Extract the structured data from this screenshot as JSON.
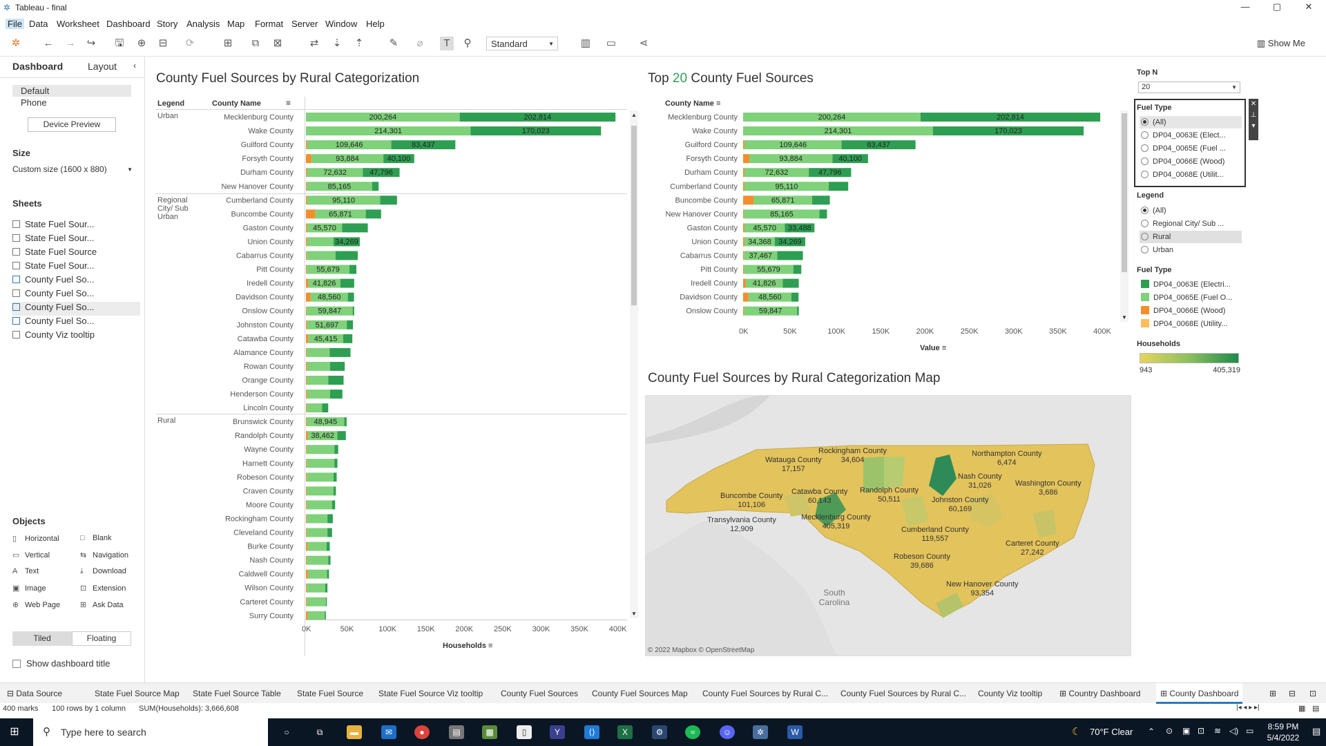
{
  "window": {
    "title": "Tableau - final",
    "min": "—",
    "max": "▢",
    "close": "✕"
  },
  "menu": [
    "File",
    "Data",
    "Worksheet",
    "Dashboard",
    "Story",
    "Analysis",
    "Map",
    "Format",
    "Server",
    "Window",
    "Help"
  ],
  "toolbar": {
    "fit": "Standard",
    "show_me": "Show Me"
  },
  "sidebar": {
    "tab_dashboard": "Dashboard",
    "tab_layout": "Layout",
    "devices": [
      "Default",
      "Phone"
    ],
    "device_preview": "Device Preview",
    "size_heading": "Size",
    "size_value": "Custom size (1600 x 880)",
    "sheets_heading": "Sheets",
    "sheets": [
      "State Fuel Sour...",
      "State Fuel Sour...",
      "State Fuel Source",
      "State Fuel Sour...",
      "County Fuel So...",
      "County Fuel So...",
      "County Fuel So...",
      "County Fuel So...",
      "County Viz tooltip"
    ],
    "objects_heading": "Objects",
    "objects": [
      [
        "▯",
        "Horizontal"
      ],
      [
        "□",
        "Blank"
      ],
      [
        "▭",
        "Vertical"
      ],
      [
        "⇆",
        "Navigation"
      ],
      [
        "A",
        "Text"
      ],
      [
        "⤓",
        "Download"
      ],
      [
        "▣",
        "Image"
      ],
      [
        "⊡",
        "Extension"
      ],
      [
        "⊕",
        "Web Page"
      ],
      [
        "⊞",
        "Ask Data"
      ]
    ],
    "tiled": "Tiled",
    "floating": "Floating",
    "show_title": "Show dashboard title"
  },
  "left_chart": {
    "title": "County Fuel Sources by Rural Categorization",
    "col_legend": "Legend",
    "col_county": "County Name",
    "segments": [
      "Urban",
      "Regional City/ Sub Urban",
      "Rural"
    ],
    "xaxis": {
      "ticks": [
        "0K",
        "50K",
        "100K",
        "150K",
        "200K",
        "250K",
        "300K",
        "350K",
        "400K"
      ],
      "label": "Households"
    }
  },
  "right_chart": {
    "title_pre": "Top",
    "title_n": "20",
    "title_post": "County Fuel Sources",
    "col_county": "County Name",
    "xaxis": {
      "ticks": [
        "0K",
        "50K",
        "100K",
        "150K",
        "200K",
        "250K",
        "300K",
        "350K",
        "400K"
      ],
      "label": "Value"
    }
  },
  "map": {
    "title": "County Fuel Sources by Rural Categorization Map",
    "credit": "© 2022 Mapbox © OpenStreetMap",
    "state_label": "South Carolina",
    "labels": [
      [
        "Rockingham County",
        "34,604"
      ],
      [
        "Northampton County",
        "6,474"
      ],
      [
        "Watauga County",
        "17,157"
      ],
      [
        "Nash County",
        "31,026"
      ],
      [
        "Washington County",
        "3,686"
      ],
      [
        "Randolph County",
        "50,511"
      ],
      [
        "Catawba County",
        "60,143"
      ],
      [
        "Buncombe County",
        "101,106"
      ],
      [
        "Johnston County",
        "60,169"
      ],
      [
        "Transylvania County",
        "12,909"
      ],
      [
        "Mecklenburg County",
        "405,319"
      ],
      [
        "Cumberland County",
        "119,557"
      ],
      [
        "Carteret County",
        "27,242"
      ],
      [
        "Robeson County",
        "39,686"
      ],
      [
        "New Hanover County",
        "93,354"
      ]
    ]
  },
  "filters": {
    "topn_title": "Top N",
    "topn_value": "20",
    "fuel_title": "Fuel Type",
    "fuel_options": [
      "(All)",
      "DP04_0063E (Elect...",
      "DP04_0065E (Fuel ...",
      "DP04_0066E (Wood)",
      "DP04_0068E (Utilit..."
    ],
    "legend_title": "Legend",
    "legend_options": [
      "(All)",
      "Regional City/ Sub ...",
      "Rural",
      "Urban"
    ],
    "fueltype_legend_title": "Fuel Type",
    "fueltype_legend": [
      "DP04_0063E (Electri...",
      "DP04_0065E (Fuel O...",
      "DP04_0066E (Wood)",
      "DP04_0068E (Utility..."
    ],
    "households_title": "Households",
    "households_min": "943",
    "households_max": "405,319"
  },
  "colors": {
    "electric": "#2e9e52",
    "fuel_oil": "#7fd17a",
    "wood": "#f28e2b",
    "utility": "#ffbe5c",
    "bar_light": "#84d47d",
    "bar_dark": "#2f9b4f"
  },
  "tabs": [
    "Data Source",
    "State Fuel Source Map",
    "State Fuel Source Table",
    "State Fuel Source",
    "State Fuel Source Viz tooltip",
    "County Fuel Sources",
    "County Fuel Sources Map",
    "County Fuel Sources by Rural C...",
    "County Fuel Sources by Rural C...",
    "County Viz tooltip",
    "Country Dashboard",
    "County Dashboard"
  ],
  "status": {
    "marks": "400 marks",
    "rows": "100 rows by 1 column",
    "sum": "SUM(Households): 3,666,608"
  },
  "taskbar": {
    "search": "Type here to search",
    "weather": "70°F  Clear",
    "time": "8:59 PM",
    "date": "5/4/2022"
  },
  "chart_data": [
    {
      "type": "bar",
      "title": "County Fuel Sources by Rural Categorization",
      "xlabel": "Households",
      "xlim": [
        0,
        420000
      ],
      "rows": [
        {
          "segment": "Urban",
          "county": "Mecklenburg County",
          "wood": 0,
          "fuel_oil": 200264,
          "electric": 202814,
          "labels": [
            "200,264",
            "202,814"
          ]
        },
        {
          "segment": "Urban",
          "county": "Wake County",
          "wood": 0,
          "fuel_oil": 214301,
          "electric": 170023,
          "labels": [
            "214,301",
            "170,023"
          ]
        },
        {
          "segment": "Urban",
          "county": "Guilford County",
          "wood": 1500,
          "fuel_oil": 109646,
          "electric": 83437,
          "labels": [
            "109,646",
            "83,437"
          ]
        },
        {
          "segment": "Urban",
          "county": "Forsyth County",
          "wood": 7000,
          "fuel_oil": 93884,
          "electric": 40100,
          "labels": [
            "93,884",
            "40,100"
          ]
        },
        {
          "segment": "Urban",
          "county": "Durham County",
          "wood": 1500,
          "fuel_oil": 72632,
          "electric": 47796,
          "labels": [
            "72,632",
            "47,796"
          ]
        },
        {
          "segment": "Urban",
          "county": "New Hanover County",
          "wood": 1000,
          "fuel_oil": 85165,
          "electric": 8500,
          "labels": [
            "85,165",
            ""
          ]
        },
        {
          "segment": "Regional City/ Sub Urban",
          "county": "Cumberland County",
          "wood": 1500,
          "fuel_oil": 95110,
          "electric": 22000,
          "labels": [
            "95,110",
            ""
          ]
        },
        {
          "segment": "Regional City/ Sub Urban",
          "county": "Buncombe County",
          "wood": 12000,
          "fuel_oil": 65871,
          "electric": 20000,
          "labels": [
            "65,871",
            ""
          ]
        },
        {
          "segment": "Regional City/ Sub Urban",
          "county": "Gaston County",
          "wood": 1500,
          "fuel_oil": 45570,
          "electric": 33488,
          "labels": [
            "45,570",
            ""
          ]
        },
        {
          "segment": "Regional City/ Sub Urban",
          "county": "Union County",
          "wood": 1500,
          "fuel_oil": 34368,
          "electric": 34269,
          "labels": [
            "",
            "34,269"
          ]
        },
        {
          "segment": "Regional City/ Sub Urban",
          "county": "Cabarrus County",
          "wood": 1000,
          "fuel_oil": 37467,
          "electric": 29000,
          "labels": [
            "",
            ""
          ]
        },
        {
          "segment": "Regional City/ Sub Urban",
          "county": "Pitt County",
          "wood": 1000,
          "fuel_oil": 55679,
          "electric": 9000,
          "labels": [
            "55,679",
            ""
          ]
        },
        {
          "segment": "Regional City/ Sub Urban",
          "county": "Iredell County",
          "wood": 3000,
          "fuel_oil": 41826,
          "electric": 18000,
          "labels": [
            "41,826",
            ""
          ]
        },
        {
          "segment": "Regional City/ Sub Urban",
          "county": "Davidson County",
          "wood": 6000,
          "fuel_oil": 48560,
          "electric": 8000,
          "labels": [
            "48,560",
            ""
          ]
        },
        {
          "segment": "Regional City/ Sub Urban",
          "county": "Onslow County",
          "wood": 1000,
          "fuel_oil": 59847,
          "electric": 2000,
          "labels": [
            "59,847",
            ""
          ]
        },
        {
          "segment": "Regional City/ Sub Urban",
          "county": "Johnston County",
          "wood": 1500,
          "fuel_oil": 51697,
          "electric": 8000,
          "labels": [
            "51,697",
            ""
          ]
        },
        {
          "segment": "Regional City/ Sub Urban",
          "county": "Catawba County",
          "wood": 3000,
          "fuel_oil": 45415,
          "electric": 12000,
          "labels": [
            "45,415",
            ""
          ]
        },
        {
          "segment": "Regional City/ Sub Urban",
          "county": "Alamance County",
          "wood": 1000,
          "fuel_oil": 30000,
          "electric": 27000,
          "labels": [
            "",
            ""
          ]
        },
        {
          "segment": "Regional City/ Sub Urban",
          "county": "Rowan County",
          "wood": 1500,
          "fuel_oil": 30000,
          "electric": 19000,
          "labels": [
            "",
            ""
          ]
        },
        {
          "segment": "Regional City/ Sub Urban",
          "county": "Orange County",
          "wood": 1000,
          "fuel_oil": 28000,
          "electric": 20000,
          "labels": [
            "",
            ""
          ]
        },
        {
          "segment": "Regional City/ Sub Urban",
          "county": "Henderson County",
          "wood": 1500,
          "fuel_oil": 30000,
          "electric": 16000,
          "labels": [
            "",
            ""
          ]
        },
        {
          "segment": "Regional City/ Sub Urban",
          "county": "Lincoln County",
          "wood": 1000,
          "fuel_oil": 20000,
          "electric": 8000,
          "labels": [
            "",
            ""
          ]
        },
        {
          "segment": "Rural",
          "county": "Brunswick County",
          "wood": 1000,
          "fuel_oil": 48945,
          "electric": 3000,
          "labels": [
            "48,945",
            ""
          ]
        },
        {
          "segment": "Rural",
          "county": "Randolph County",
          "wood": 2500,
          "fuel_oil": 38462,
          "electric": 11000,
          "labels": [
            "38,462",
            ""
          ]
        },
        {
          "segment": "Rural",
          "county": "Wayne County",
          "wood": 1000,
          "fuel_oil": 36000,
          "electric": 5000,
          "labels": [
            "",
            ""
          ]
        },
        {
          "segment": "Rural",
          "county": "Harnett County",
          "wood": 1000,
          "fuel_oil": 36000,
          "electric": 4000,
          "labels": [
            "",
            ""
          ]
        },
        {
          "segment": "Rural",
          "county": "Robeson County",
          "wood": 1000,
          "fuel_oil": 35000,
          "electric": 4000,
          "labels": [
            "",
            ""
          ]
        },
        {
          "segment": "Rural",
          "county": "Craven County",
          "wood": 1000,
          "fuel_oil": 35000,
          "electric": 3000,
          "labels": [
            "",
            ""
          ]
        },
        {
          "segment": "Rural",
          "county": "Moore County",
          "wood": 1000,
          "fuel_oil": 33000,
          "electric": 4000,
          "labels": [
            "",
            ""
          ]
        },
        {
          "segment": "Rural",
          "county": "Rockingham County",
          "wood": 1000,
          "fuel_oil": 27000,
          "electric": 7000,
          "labels": [
            "",
            ""
          ]
        },
        {
          "segment": "Rural",
          "county": "Cleveland County",
          "wood": 1000,
          "fuel_oil": 27000,
          "electric": 6000,
          "labels": [
            "",
            ""
          ]
        },
        {
          "segment": "Rural",
          "county": "Burke County",
          "wood": 2000,
          "fuel_oil": 25000,
          "electric": 4000,
          "labels": [
            "",
            ""
          ]
        },
        {
          "segment": "Rural",
          "county": "Nash County",
          "wood": 1000,
          "fuel_oil": 28000,
          "electric": 3000,
          "labels": [
            "",
            ""
          ]
        },
        {
          "segment": "Rural",
          "county": "Caldwell County",
          "wood": 2500,
          "fuel_oil": 25000,
          "electric": 2500,
          "labels": [
            "",
            ""
          ]
        },
        {
          "segment": "Rural",
          "county": "Wilson County",
          "wood": 1000,
          "fuel_oil": 24000,
          "electric": 3000,
          "labels": [
            "",
            ""
          ]
        },
        {
          "segment": "Rural",
          "county": "Carteret County",
          "wood": 1000,
          "fuel_oil": 25000,
          "electric": 1200,
          "labels": [
            "",
            ""
          ]
        },
        {
          "segment": "Rural",
          "county": "Surry County",
          "wood": 2500,
          "fuel_oil": 22000,
          "electric": 1500,
          "labels": [
            "",
            ""
          ]
        }
      ]
    },
    {
      "type": "bar",
      "title": "Top 20 County Fuel Sources",
      "xlabel": "Value",
      "xlim": [
        0,
        410000
      ],
      "rows": [
        {
          "county": "Mecklenburg County",
          "wood": 0,
          "fuel_oil": 200264,
          "electric": 202814,
          "labels": [
            "200,264",
            "202,814"
          ]
        },
        {
          "county": "Wake County",
          "wood": 0,
          "fuel_oil": 214301,
          "electric": 170023,
          "labels": [
            "214,301",
            "170,023"
          ]
        },
        {
          "county": "Guilford County",
          "wood": 1500,
          "fuel_oil": 109646,
          "electric": 83437,
          "labels": [
            "109,646",
            "83,437"
          ]
        },
        {
          "county": "Forsyth County",
          "wood": 7000,
          "fuel_oil": 93884,
          "electric": 40100,
          "labels": [
            "93,884",
            "40,100"
          ]
        },
        {
          "county": "Durham County",
          "wood": 1500,
          "fuel_oil": 72632,
          "electric": 47796,
          "labels": [
            "72,632",
            "47,796"
          ]
        },
        {
          "county": "Cumberland County",
          "wood": 1500,
          "fuel_oil": 95110,
          "electric": 22000,
          "labels": [
            "95,110",
            ""
          ]
        },
        {
          "county": "Buncombe County",
          "wood": 12000,
          "fuel_oil": 65871,
          "electric": 20000,
          "labels": [
            "65,871",
            ""
          ]
        },
        {
          "county": "New Hanover County",
          "wood": 1000,
          "fuel_oil": 85165,
          "electric": 8500,
          "labels": [
            "85,165",
            ""
          ]
        },
        {
          "county": "Gaston County",
          "wood": 1500,
          "fuel_oil": 45570,
          "electric": 33488,
          "labels": [
            "45,570",
            "33,488"
          ]
        },
        {
          "county": "Union County",
          "wood": 1500,
          "fuel_oil": 34368,
          "electric": 34269,
          "labels": [
            "34,368",
            "34,269"
          ]
        },
        {
          "county": "Cabarrus County",
          "wood": 1000,
          "fuel_oil": 37467,
          "electric": 29000,
          "labels": [
            "37,467",
            ""
          ]
        },
        {
          "county": "Pitt County",
          "wood": 1000,
          "fuel_oil": 55679,
          "electric": 9000,
          "labels": [
            "55,679",
            ""
          ]
        },
        {
          "county": "Iredell County",
          "wood": 3000,
          "fuel_oil": 41826,
          "electric": 18000,
          "labels": [
            "41,826",
            ""
          ]
        },
        {
          "county": "Davidson County",
          "wood": 6000,
          "fuel_oil": 48560,
          "electric": 8000,
          "labels": [
            "48,560",
            ""
          ]
        },
        {
          "county": "Onslow County",
          "wood": 1000,
          "fuel_oil": 59847,
          "electric": 2000,
          "labels": [
            "59,847",
            ""
          ]
        }
      ]
    }
  ]
}
